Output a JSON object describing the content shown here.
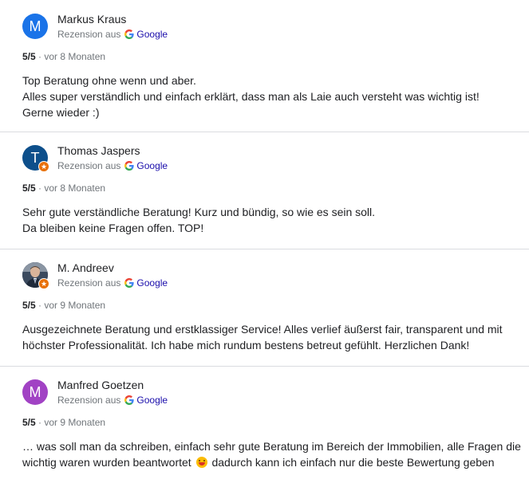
{
  "reviews": [
    {
      "name": "Markus Kraus",
      "avatar_letter": "M",
      "avatar_color": "#1a73e8",
      "source_label": "Rezension aus",
      "source_name": "Google",
      "score": "5/5",
      "time": "· vor 8 Monaten",
      "text": "Top Beratung ohne wenn und aber.\nAlles super verständlich und einfach erklärt, dass man als Laie auch versteht was wichtig ist!\nGerne wieder :)"
    },
    {
      "name": "Thomas Jaspers",
      "avatar_letter": "T",
      "avatar_color": "#0d4f8b",
      "source_label": "Rezension aus",
      "source_name": "Google",
      "score": "5/5",
      "time": "· vor 8 Monaten",
      "text": "Sehr gute verständliche Beratung! Kurz und bündig, so wie es sein soll.\nDa bleiben keine Fragen offen. TOP!"
    },
    {
      "name": "M. Andreev",
      "source_label": "Rezension aus",
      "source_name": "Google",
      "score": "5/5",
      "time": "· vor 9 Monaten",
      "text": "Ausgezeichnete Beratung und erstklassiger Service! Alles verlief äußerst fair, transparent und mit höchster Professionalität. Ich habe mich rundum bestens betreut gefühlt. Herzlichen Dank!"
    },
    {
      "name": "Manfred Goetzen",
      "avatar_letter": "M",
      "avatar_color": "#a142c4",
      "source_label": "Rezension aus",
      "source_name": "Google",
      "score": "5/5",
      "time": "· vor 9 Monaten",
      "text_before_emoji": "… was soll man da schreiben, einfach sehr gute Beratung im Bereich der Immobilien, alle Fragen die wichtig waren wurden beantwortet",
      "text_after_emoji": " dadurch kann ich einfach nur die beste Bewertung geben"
    }
  ],
  "badge_icon": "local-guide-star-icon"
}
